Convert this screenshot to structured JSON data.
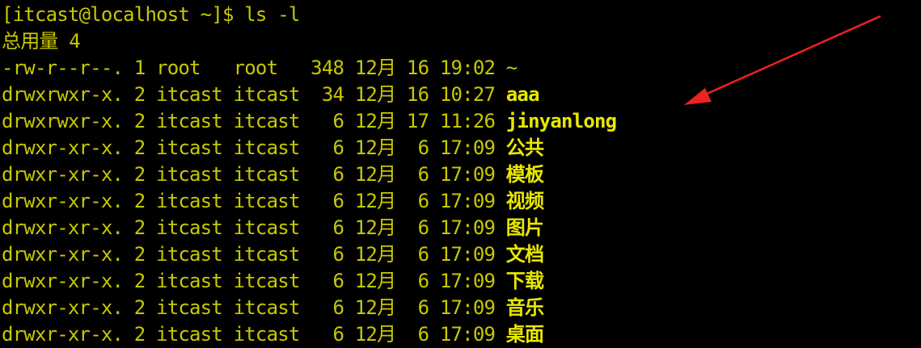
{
  "terminal": {
    "prompt": "[itcast@localhost ~]$ ls -l",
    "total": "总用量 4",
    "rows": [
      {
        "perm": "-rw-r--r--.",
        "links": "1",
        "user": "root  ",
        "group": "root  ",
        "size": "348",
        "month": "12月",
        "day": "16",
        "time": "19:02",
        "name": "~",
        "bold": false
      },
      {
        "perm": "drwxrwxr-x.",
        "links": "2",
        "user": "itcast",
        "group": "itcast",
        "size": " 34",
        "month": "12月",
        "day": "16",
        "time": "10:27",
        "name": "aaa",
        "bold": true
      },
      {
        "perm": "drwxrwxr-x.",
        "links": "2",
        "user": "itcast",
        "group": "itcast",
        "size": "  6",
        "month": "12月",
        "day": "17",
        "time": "11:26",
        "name": "jinyanlong",
        "bold": true
      },
      {
        "perm": "drwxr-xr-x.",
        "links": "2",
        "user": "itcast",
        "group": "itcast",
        "size": "  6",
        "month": "12月",
        "day": " 6",
        "time": "17:09",
        "name": "公共",
        "bold": true
      },
      {
        "perm": "drwxr-xr-x.",
        "links": "2",
        "user": "itcast",
        "group": "itcast",
        "size": "  6",
        "month": "12月",
        "day": " 6",
        "time": "17:09",
        "name": "模板",
        "bold": true
      },
      {
        "perm": "drwxr-xr-x.",
        "links": "2",
        "user": "itcast",
        "group": "itcast",
        "size": "  6",
        "month": "12月",
        "day": " 6",
        "time": "17:09",
        "name": "视频",
        "bold": true
      },
      {
        "perm": "drwxr-xr-x.",
        "links": "2",
        "user": "itcast",
        "group": "itcast",
        "size": "  6",
        "month": "12月",
        "day": " 6",
        "time": "17:09",
        "name": "图片",
        "bold": true
      },
      {
        "perm": "drwxr-xr-x.",
        "links": "2",
        "user": "itcast",
        "group": "itcast",
        "size": "  6",
        "month": "12月",
        "day": " 6",
        "time": "17:09",
        "name": "文档",
        "bold": true
      },
      {
        "perm": "drwxr-xr-x.",
        "links": "2",
        "user": "itcast",
        "group": "itcast",
        "size": "  6",
        "month": "12月",
        "day": " 6",
        "time": "17:09",
        "name": "下载",
        "bold": true
      },
      {
        "perm": "drwxr-xr-x.",
        "links": "2",
        "user": "itcast",
        "group": "itcast",
        "size": "  6",
        "month": "12月",
        "day": " 6",
        "time": "17:09",
        "name": "音乐",
        "bold": true
      },
      {
        "perm": "drwxr-xr-x.",
        "links": "2",
        "user": "itcast",
        "group": "itcast",
        "size": "  6",
        "month": "12月",
        "day": " 6",
        "time": "17:09",
        "name": "桌面",
        "bold": true
      }
    ]
  },
  "colors": {
    "background": "#000000",
    "text": "#c8c800",
    "bold_text": "#e8e800",
    "arrow": "#ee2222"
  }
}
